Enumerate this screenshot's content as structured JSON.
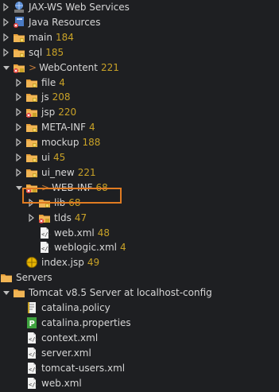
{
  "rows": [
    {
      "label": "JAX-WS Web Services",
      "count": "",
      "gt": false,
      "indent": 0,
      "tw": "closed",
      "icon": "ws"
    },
    {
      "label": "Java Resources",
      "count": "",
      "gt": false,
      "indent": 0,
      "tw": "closed",
      "icon": "jres"
    },
    {
      "label": "main",
      "count": "184",
      "gt": false,
      "indent": 0,
      "tw": "closed",
      "icon": "folder-pkg"
    },
    {
      "label": "sql",
      "count": "185",
      "gt": false,
      "indent": 0,
      "tw": "closed",
      "icon": "folder-pkg"
    },
    {
      "label": "WebContent",
      "count": "221",
      "gt": true,
      "indent": 0,
      "tw": "open",
      "icon": "folder-err"
    },
    {
      "label": "file",
      "count": "4",
      "gt": false,
      "indent": 1,
      "tw": "closed",
      "icon": "folder-pkg"
    },
    {
      "label": "js",
      "count": "208",
      "gt": false,
      "indent": 1,
      "tw": "closed",
      "icon": "folder-pkg"
    },
    {
      "label": "jsp",
      "count": "220",
      "gt": false,
      "indent": 1,
      "tw": "closed",
      "icon": "folder-err"
    },
    {
      "label": "META-INF",
      "count": "4",
      "gt": false,
      "indent": 1,
      "tw": "closed",
      "icon": "folder-pkg"
    },
    {
      "label": "mockup",
      "count": "188",
      "gt": false,
      "indent": 1,
      "tw": "closed",
      "icon": "folder-pkg"
    },
    {
      "label": "ui",
      "count": "45",
      "gt": false,
      "indent": 1,
      "tw": "closed",
      "icon": "folder-pkg"
    },
    {
      "label": "ui_new",
      "count": "221",
      "gt": false,
      "indent": 1,
      "tw": "closed",
      "icon": "folder-pkg"
    },
    {
      "label": "WEB-INF",
      "count": "68",
      "gt": true,
      "indent": 1,
      "tw": "open",
      "icon": "folder-err"
    },
    {
      "label": "lib",
      "count": "68",
      "gt": false,
      "indent": 2,
      "tw": "closed",
      "icon": "folder-pkg"
    },
    {
      "label": "tlds",
      "count": "47",
      "gt": false,
      "indent": 2,
      "tw": "closed",
      "icon": "folder-err"
    },
    {
      "label": "web.xml",
      "count": "48",
      "gt": false,
      "indent": 2,
      "tw": "none",
      "icon": "xml"
    },
    {
      "label": "weblogic.xml",
      "count": "4",
      "gt": false,
      "indent": 2,
      "tw": "none",
      "icon": "xml"
    },
    {
      "label": "index.jsp",
      "count": "49",
      "gt": false,
      "indent": 1,
      "tw": "none",
      "icon": "jsp"
    },
    {
      "label": "Servers",
      "count": "",
      "gt": false,
      "indent": -1,
      "tw": "none",
      "icon": "folder-plain"
    },
    {
      "label": "Tomcat v8.5 Server at localhost-config",
      "count": "",
      "gt": false,
      "indent": 0,
      "tw": "open",
      "icon": "folder-plain"
    },
    {
      "label": "catalina.policy",
      "count": "",
      "gt": false,
      "indent": 1,
      "tw": "none",
      "icon": "policy"
    },
    {
      "label": "catalina.properties",
      "count": "",
      "gt": false,
      "indent": 1,
      "tw": "none",
      "icon": "props"
    },
    {
      "label": "context.xml",
      "count": "",
      "gt": false,
      "indent": 1,
      "tw": "none",
      "icon": "xml"
    },
    {
      "label": "server.xml",
      "count": "",
      "gt": false,
      "indent": 1,
      "tw": "none",
      "icon": "xml"
    },
    {
      "label": "tomcat-users.xml",
      "count": "",
      "gt": false,
      "indent": 1,
      "tw": "none",
      "icon": "xml"
    },
    {
      "label": "web.xml",
      "count": "",
      "gt": false,
      "indent": 1,
      "tw": "none",
      "icon": "xml"
    }
  ],
  "highlight_label": "lib",
  "colors": {
    "background": "#1e1f22",
    "text": "#d6d6d6",
    "count": "#c9a227",
    "highlight": "#e07b22"
  }
}
